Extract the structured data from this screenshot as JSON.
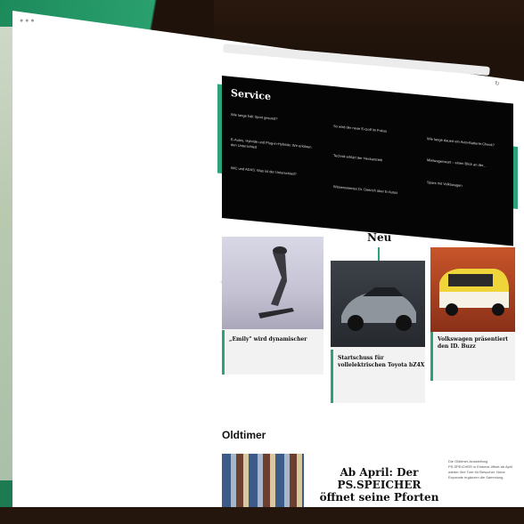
{
  "service": {
    "title": "Service",
    "links": [
      "Wie lange hält Sport gesund?",
      "E-Autos, Hybride und Plug-in-Hybride: Wir erklären den Unterschied",
      "IMC und ADAS: Was ist der Unterschied?",
      "So wird der neue E-Golf im Fokus",
      "Technik erklärt der Heckantrieb",
      "Wissenswertes Dr. Dietrich über E-Autos",
      "Wie lange dauert ein Auto-Batterie-Check?",
      "Mietwagenstart – einen Blick an der...",
      "Spare mit Volkswagen"
    ]
  },
  "sections": {
    "neu": "Neu",
    "oldtimer": "Oldtimer"
  },
  "cards": [
    {
      "caption": "„Emily\" wird dynamischer"
    },
    {
      "caption": "Startschuss für vollelektrischen Toyota bZ4X"
    },
    {
      "caption": "Volkswagen präsentiert den ID. Buzz"
    }
  ],
  "oldtimer": {
    "headline": "Ab April: Der PS.SPEICHER öffnet seine Pforten",
    "side_text": "Die Oldtimer-Ausstellung PS.SPEICHER in Einbeck öffnet ab April wieder ihre Tore für Besucher. Neue Exponate ergänzen die Sammlung."
  },
  "colors": {
    "accent": "#2aa37a",
    "service_bg": "#050505"
  }
}
